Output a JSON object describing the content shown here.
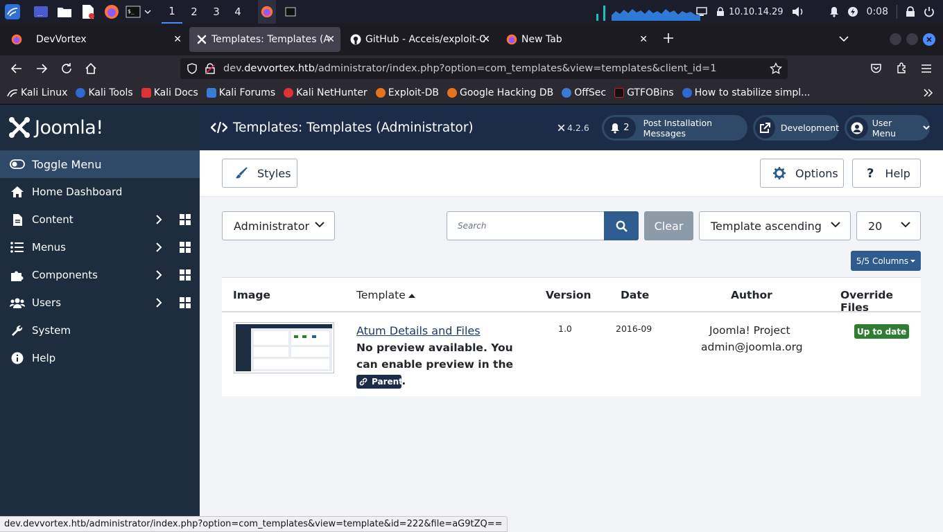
{
  "taskbar": {
    "workspaces": [
      "1",
      "2",
      "3",
      "4"
    ],
    "ip": "10.10.14.29",
    "clock": "0:08"
  },
  "browser": {
    "tabs": [
      {
        "label": "DevVortex"
      },
      {
        "label": "Templates: Templates (Ad"
      },
      {
        "label": "GitHub - Acceis/exploit-C"
      },
      {
        "label": "New Tab"
      }
    ],
    "url_prefix": "dev.",
    "url_host": "devvortex.htb",
    "url_path": "/administrator/index.php?option=com_templates&view=templates&client_id=1",
    "bookmarks": [
      {
        "label": "Kali Linux",
        "color": "#3a7bd5"
      },
      {
        "label": "Kali Tools",
        "color": "#2e6bd1"
      },
      {
        "label": "Kali Docs",
        "color": "#d33"
      },
      {
        "label": "Kali Forums",
        "color": "#3a7bd5"
      },
      {
        "label": "Kali NetHunter",
        "color": "#d33"
      },
      {
        "label": "Exploit-DB",
        "color": "#e8731a"
      },
      {
        "label": "Google Hacking DB",
        "color": "#e8731a"
      },
      {
        "label": "OffSec",
        "color": "#3a7bd5"
      },
      {
        "label": "GTFOBins",
        "color": "#c22"
      },
      {
        "label": "How to stabilize simpl...",
        "color": "#2e6bd1"
      }
    ],
    "status_url": "dev.devvortex.htb/administrator/index.php?option=com_templates&view=template&id=222&file=aG9tZQ=="
  },
  "sidebar": {
    "logo": "Joomla!",
    "toggle": "Toggle Menu",
    "items": [
      {
        "label": "Home Dashboard",
        "icon": "home-icon",
        "sub": false
      },
      {
        "label": "Content",
        "icon": "file-icon",
        "sub": true
      },
      {
        "label": "Menus",
        "icon": "list-icon",
        "sub": true
      },
      {
        "label": "Components",
        "icon": "puzzle-icon",
        "sub": true
      },
      {
        "label": "Users",
        "icon": "users-icon",
        "sub": true
      },
      {
        "label": "System",
        "icon": "wrench-icon",
        "sub": false
      },
      {
        "label": "Help",
        "icon": "info-icon",
        "sub": false
      }
    ]
  },
  "header": {
    "title": "Templates: Templates (Administrator)",
    "version": "4.2.6",
    "notification_count": "2",
    "post_install": "Post Installation Messages",
    "development": "Development",
    "user_menu": "User Menu"
  },
  "toolbar": {
    "styles": "Styles",
    "options": "Options",
    "help": "Help"
  },
  "filters": {
    "client": "Administrator",
    "search_placeholder": "Search",
    "clear": "Clear",
    "ordering": "Template ascending",
    "limit": "20",
    "columns": "5/5 Columns"
  },
  "table": {
    "headers": [
      "Image",
      "Template",
      "Version",
      "Date",
      "Author",
      "Override Files"
    ],
    "rows": [
      {
        "template": "Atum Details and Files",
        "note": "No preview available. You can enable preview in the options.",
        "badge": "Parent",
        "version": "1.0",
        "date": "2016-09",
        "author": "Joomla! Project",
        "email": "admin@joomla.org",
        "override": "Up to date"
      }
    ]
  },
  "colors": {
    "sidebar": "#1e2c3f",
    "header": "#1b2c48",
    "primary": "#2f5c8f",
    "success": "#2f7d32"
  }
}
